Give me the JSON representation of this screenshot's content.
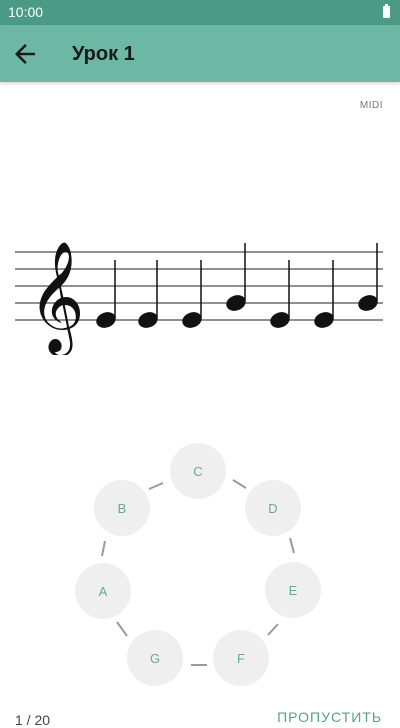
{
  "status_bar": {
    "time": "10:00"
  },
  "app_bar": {
    "title": "Урок 1",
    "back_icon": "arrow-left-icon"
  },
  "midi_label": "MIDI",
  "staff": {
    "clef": "treble-clef-icon",
    "note_positions": [
      0,
      0,
      0,
      2,
      0,
      0,
      2
    ]
  },
  "note_buttons": [
    {
      "label": "C"
    },
    {
      "label": "D"
    },
    {
      "label": "E"
    },
    {
      "label": "F"
    },
    {
      "label": "G"
    },
    {
      "label": "A"
    },
    {
      "label": "B"
    }
  ],
  "footer": {
    "progress": "1 / 20",
    "skip_label": "ПРОПУСТИТЬ"
  },
  "colors": {
    "status_bar": "#4b9a86",
    "app_bar": "#6cb8a5",
    "accent": "#5a9f8e",
    "note_button_bg": "#efefef"
  }
}
